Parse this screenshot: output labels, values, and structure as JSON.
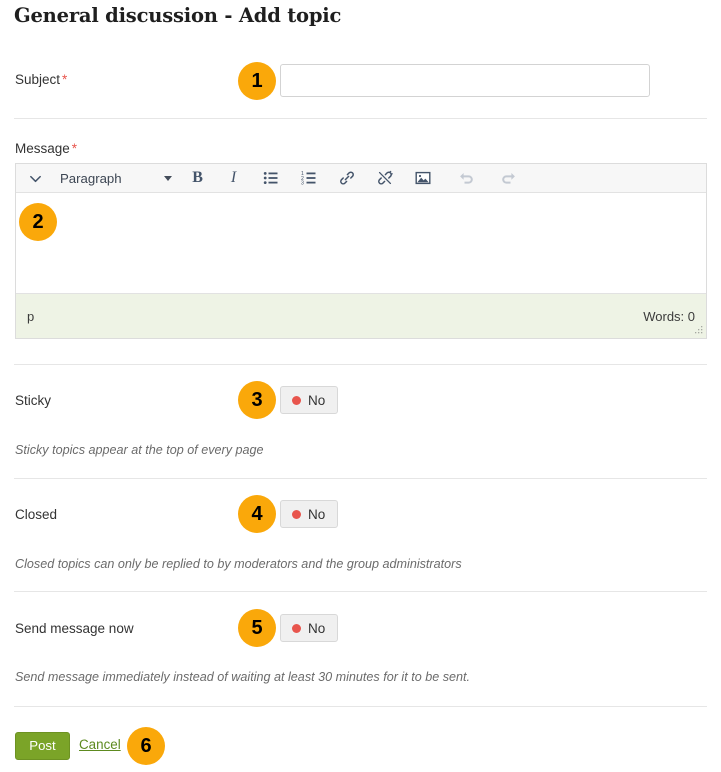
{
  "page": {
    "title": "General discussion - Add topic"
  },
  "fields": {
    "subject": {
      "label": "Subject",
      "required_marker": "*",
      "value": "",
      "placeholder": ""
    },
    "message": {
      "label": "Message",
      "required_marker": "*",
      "value": ""
    },
    "sticky": {
      "label": "Sticky",
      "toggle_value": "No",
      "help": "Sticky topics appear at the top of every page"
    },
    "closed": {
      "label": "Closed",
      "toggle_value": "No",
      "help": "Closed topics can only be replied to by moderators and the group administrators"
    },
    "send_message_now": {
      "label": "Send message now",
      "toggle_value": "No",
      "help": "Send message immediately instead of waiting at least 30 minutes for it to be sent."
    }
  },
  "editor": {
    "toolbar": {
      "toggle_icon": "chevron-down-icon",
      "format_label": "Paragraph",
      "buttons": [
        {
          "name": "bold-icon",
          "label": "B"
        },
        {
          "name": "italic-icon",
          "label": "I"
        },
        {
          "name": "bullet-list-icon",
          "label": ""
        },
        {
          "name": "numbered-list-icon",
          "label": ""
        },
        {
          "name": "link-icon",
          "label": ""
        },
        {
          "name": "unlink-icon",
          "label": ""
        },
        {
          "name": "image-icon",
          "label": ""
        },
        {
          "name": "undo-icon",
          "label": ""
        },
        {
          "name": "redo-icon",
          "label": ""
        }
      ]
    },
    "statusbar": {
      "path": "p",
      "word_count": "Words: 0"
    }
  },
  "actions": {
    "post_label": "Post",
    "cancel_label": "Cancel"
  },
  "badges": [
    {
      "number": "1"
    },
    {
      "number": "2"
    },
    {
      "number": "3"
    },
    {
      "number": "4"
    },
    {
      "number": "5"
    },
    {
      "number": "6"
    }
  ],
  "colors": {
    "badge": "#faa80a",
    "required": "#e8554d",
    "toggle_dot": "#e8554d",
    "post_button": "#7ba428",
    "cancel_link": "#5d8a1f",
    "statusbar_bg": "#eef3e5",
    "toolbar_bg": "#f7f7f7",
    "separator": "#e6e6e6"
  }
}
